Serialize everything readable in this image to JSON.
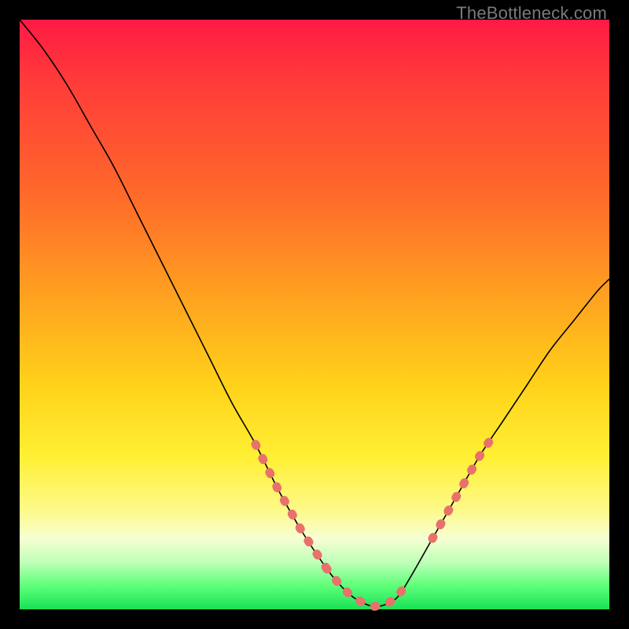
{
  "watermark": "TheBottleneck.com",
  "colors": {
    "background": "#000000",
    "curve": "#000000",
    "dot_overlay": "#e8726b",
    "gradient_stops": [
      "#ff1a44",
      "#ff3a3a",
      "#ff6a2a",
      "#ffa51f",
      "#ffd21a",
      "#ffef33",
      "#fdf987",
      "#f6ffd2",
      "#bfffb8",
      "#5eff79",
      "#18e257"
    ]
  },
  "chart_data": {
    "type": "line",
    "title": "",
    "xlabel": "",
    "ylabel": "",
    "xlim": [
      0,
      100
    ],
    "ylim": [
      0,
      100
    ],
    "grid": false,
    "series": [
      {
        "name": "bottleneck-curve",
        "x": [
          0,
          4,
          8,
          12,
          16,
          20,
          24,
          28,
          32,
          36,
          40,
          44,
          48,
          52,
          54,
          56,
          58,
          60,
          62,
          64,
          66,
          70,
          74,
          78,
          82,
          86,
          90,
          94,
          98,
          100
        ],
        "y": [
          100,
          95,
          89,
          82,
          75,
          67,
          59,
          51,
          43,
          35,
          28,
          20,
          13,
          7,
          4.5,
          2.5,
          1.2,
          0.5,
          0.8,
          2,
          5,
          12,
          19,
          26,
          32,
          38,
          44,
          49,
          54,
          56
        ]
      }
    ],
    "highlight_segments": [
      {
        "name": "left-dots",
        "x_range": [
          40,
          52
        ]
      },
      {
        "name": "valley-dots",
        "x_range": [
          52,
          66
        ]
      },
      {
        "name": "right-dots",
        "x_range": [
          70,
          80
        ]
      }
    ],
    "annotations": []
  }
}
